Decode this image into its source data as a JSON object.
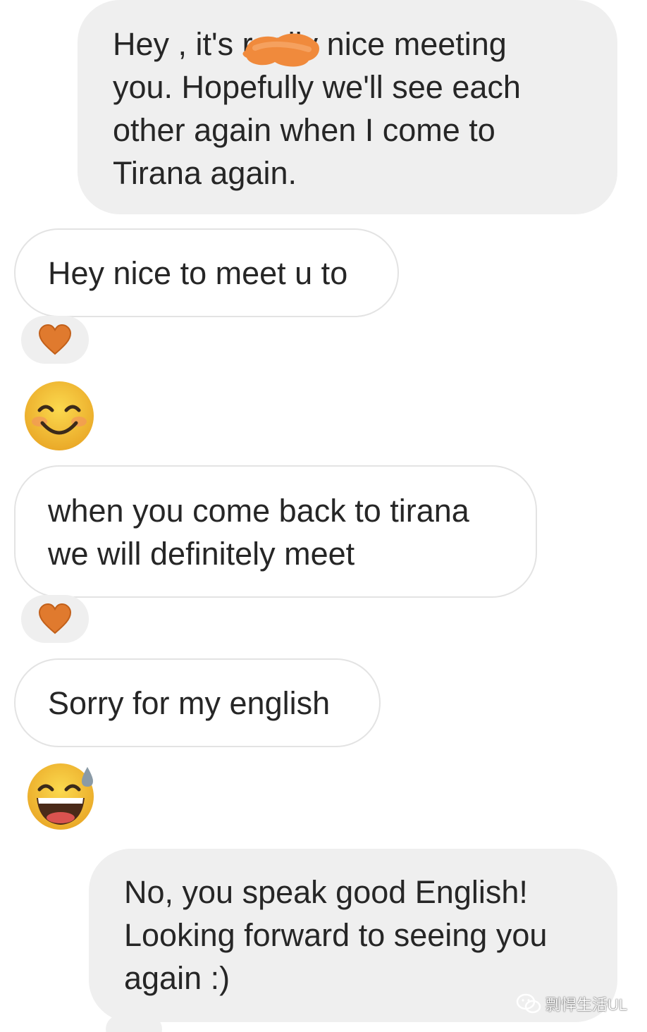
{
  "messages": [
    {
      "id": "m1",
      "direction": "outgoing",
      "text": "Hey      , it's really nice meeting\nyou. Hopefully we'll see each\nother again when I come to\nTirana again."
    },
    {
      "id": "m2",
      "direction": "incoming",
      "text": "Hey nice to meet u to",
      "reaction": "heart"
    },
    {
      "id": "m3",
      "direction": "incoming",
      "emoji": "smiling-face-icon"
    },
    {
      "id": "m4",
      "direction": "incoming",
      "text": "when you come back to tirana\nwe will definitely meet",
      "reaction": "heart"
    },
    {
      "id": "m5",
      "direction": "incoming",
      "text": "Sorry for my english"
    },
    {
      "id": "m6",
      "direction": "incoming",
      "emoji": "grinning-sweat-icon"
    },
    {
      "id": "m7",
      "direction": "outgoing",
      "text": "No, you speak good English!\nLooking forward to seeing you\nagain :)"
    }
  ],
  "watermark": {
    "text": "剽悍生活UL"
  },
  "colors": {
    "outgoing_bubble": "#efefef",
    "incoming_border": "#e3e3e3",
    "text": "#262626",
    "reaction_heart": "#e07a2e",
    "redaction": "#f08a3c",
    "emoji_face": "#f6c338"
  }
}
